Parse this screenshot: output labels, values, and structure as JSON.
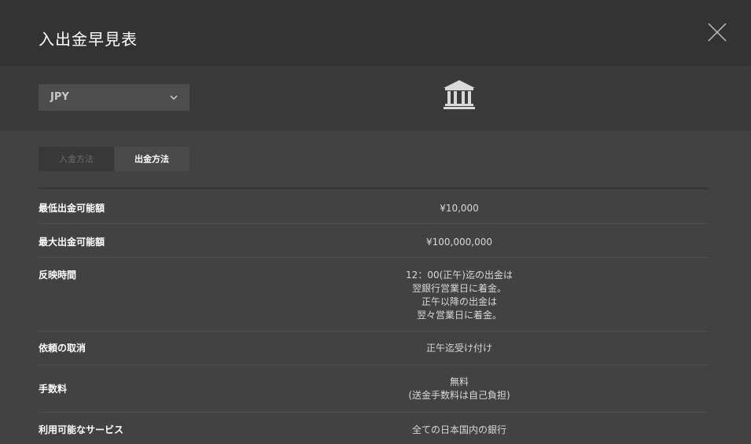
{
  "header": {
    "title": "入出金早見表"
  },
  "toolbar": {
    "currency": "JPY",
    "icon": "bank-icon"
  },
  "tabs": [
    {
      "label": "入金方法",
      "active": false
    },
    {
      "label": "出金方法",
      "active": true
    }
  ],
  "rows": [
    {
      "label": "最低出金可能額",
      "value": "¥10,000"
    },
    {
      "label": "最大出金可能額",
      "value": "¥100,000,000"
    },
    {
      "label": "反映時間",
      "value": "12：00(正午)迄の出金は\n翌銀行営業日に着金。\n正午以降の出金は\n翌々営業日に着金。"
    },
    {
      "label": "依頼の取消",
      "value": "正午迄受け付け"
    },
    {
      "label": "手数料",
      "value": "無料\n(送金手数料は自己負担)"
    },
    {
      "label": "利用可能なサービス",
      "value": "全ての日本国内の銀行"
    }
  ],
  "colors": {
    "background": "#424242",
    "header": "#333333",
    "toolbar": "#3a3a3a"
  }
}
